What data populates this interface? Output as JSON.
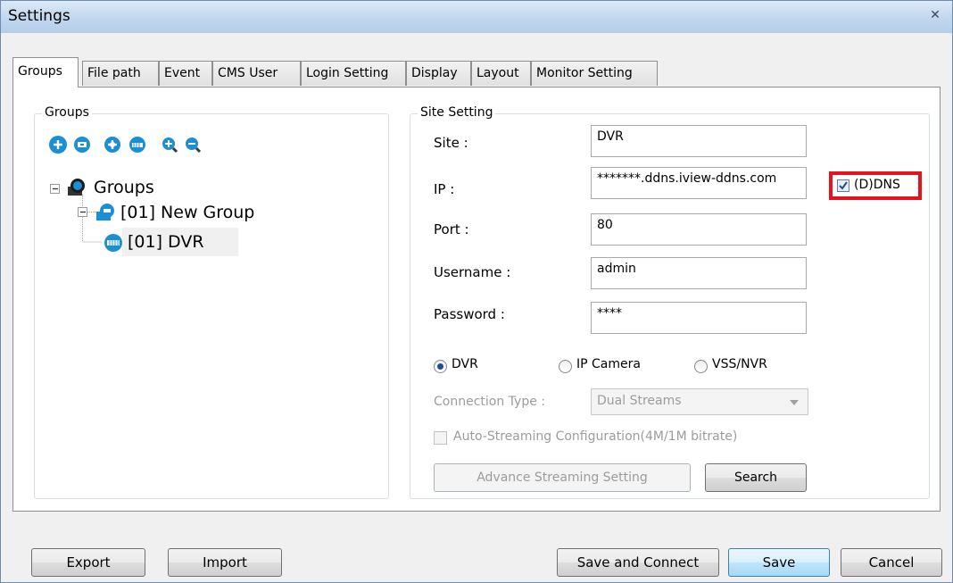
{
  "window": {
    "title": "Settings",
    "close_glyph": "✕"
  },
  "tabs": [
    {
      "label": "Groups"
    },
    {
      "label": "File path"
    },
    {
      "label": "Event"
    },
    {
      "label": "CMS User"
    },
    {
      "label": "Login Setting"
    },
    {
      "label": "Display"
    },
    {
      "label": "Layout"
    },
    {
      "label": "Monitor Setting"
    }
  ],
  "groups_panel": {
    "label": "Groups",
    "toolbar_icons": [
      "add-group-icon",
      "edit-group-icon",
      "add-site-icon",
      "edit-site-icon",
      "zoom-in-icon",
      "zoom-out-icon"
    ],
    "tree": {
      "root": "Groups",
      "group": "[01] New Group",
      "site": "[01] DVR"
    }
  },
  "site_setting": {
    "label": "Site Setting",
    "site_label": "Site :",
    "site_value": "DVR",
    "ip_label": "IP :",
    "ip_value": "*******.ddns.iview-ddns.com",
    "ddns_label": "(D)DNS",
    "ddns_checked": true,
    "port_label": "Port :",
    "port_value": "80",
    "username_label": "Username :",
    "username_value": "admin",
    "password_label": "Password :",
    "password_value": "****",
    "device_types": [
      "DVR",
      "IP Camera",
      "VSS/NVR"
    ],
    "device_type_selected": "DVR",
    "connection_type_label": "Connection Type :",
    "connection_type_value": "Dual Streams",
    "auto_streaming_label": "Auto-Streaming Configuration(4M/1M bitrate)",
    "advance_button": "Advance Streaming Setting",
    "search_button": "Search"
  },
  "footer": {
    "export": "Export",
    "import": "Import",
    "save_connect": "Save and Connect",
    "save": "Save",
    "cancel": "Cancel"
  },
  "colors": {
    "highlight_box": "#e8121c",
    "accent": "#1b8fd6"
  }
}
